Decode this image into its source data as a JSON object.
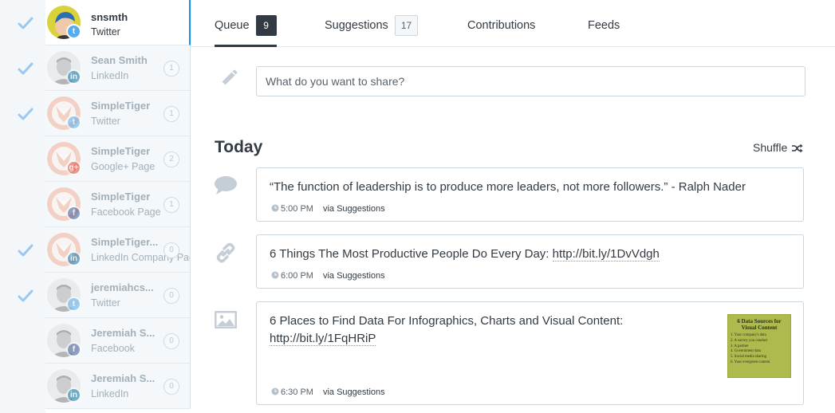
{
  "sidebar": {
    "accounts": [
      {
        "name": "snsmth",
        "network": "Twitter",
        "count": "",
        "checked": true
      },
      {
        "name": "Sean Smith",
        "network": "LinkedIn",
        "count": "1",
        "checked": true
      },
      {
        "name": "SimpleTiger",
        "network": "Twitter",
        "count": "1",
        "checked": true
      },
      {
        "name": "SimpleTiger",
        "network": "Google+ Page",
        "count": "2",
        "checked": false
      },
      {
        "name": "SimpleTiger",
        "network": "Facebook Page",
        "count": "1",
        "checked": false
      },
      {
        "name": "SimpleTiger...",
        "network": "LinkedIn Company Page",
        "count": "0",
        "checked": true
      },
      {
        "name": "jeremiahcs...",
        "network": "Twitter",
        "count": "0",
        "checked": true
      },
      {
        "name": "Jeremiah S...",
        "network": "Facebook",
        "count": "0",
        "checked": false
      },
      {
        "name": "Jeremiah S...",
        "network": "LinkedIn",
        "count": "0",
        "checked": false
      }
    ]
  },
  "tabs": [
    {
      "label": "Queue",
      "count": "9",
      "active": true
    },
    {
      "label": "Suggestions",
      "count": "17",
      "active": false
    },
    {
      "label": "Contributions",
      "count": "",
      "active": false
    },
    {
      "label": "Feeds",
      "count": "",
      "active": false
    }
  ],
  "composer": {
    "placeholder": "What do you want to share?"
  },
  "queue": {
    "day_label": "Today",
    "shuffle_label": "Shuffle",
    "posts": [
      {
        "text": "“The function of leadership is to produce more leaders, not more followers.” - Ralph Nader",
        "link": "",
        "time": "5:00 PM",
        "via": "via Suggestions"
      },
      {
        "text": "6 Things The Most Productive People Do Every Day: ",
        "link": "http://bit.ly/1DvVdgh",
        "time": "6:00 PM",
        "via": "via Suggestions"
      },
      {
        "text": "6 Places to Find Data For Infographics, Charts and Visual Content: ",
        "link": "http://bit.ly/1FqHRiP",
        "time": "6:30 PM",
        "via": "via Suggestions",
        "thumbnail": {
          "title": "6 Data Sources for Visual Content",
          "lines": [
            "1. Your company's data",
            "2. A survey you conduct",
            "3. A partner",
            "4. Government data",
            "5. Social media sharing",
            "6. Your evergreen content"
          ]
        }
      }
    ]
  },
  "colors": {
    "accent": "#168eea",
    "text": "#323b43",
    "muted": "#a4b0b9",
    "check": "#9bc8f0"
  }
}
